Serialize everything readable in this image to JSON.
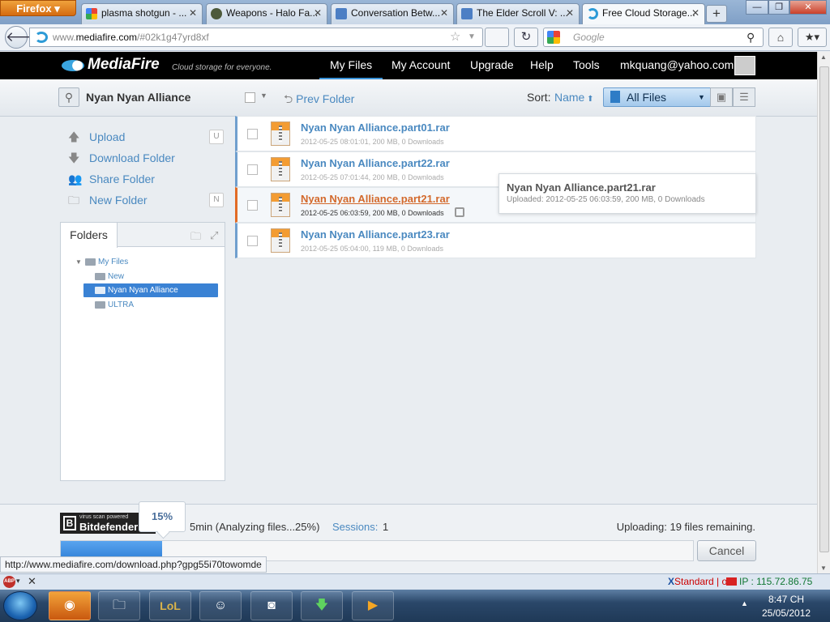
{
  "browser": {
    "menu_label": "Firefox",
    "tabs": [
      {
        "label": "plasma shotgun - ...",
        "favicon": "google-favicon"
      },
      {
        "label": "Weapons - Halo Fa...",
        "favicon": "halo-favicon"
      },
      {
        "label": "Conversation Betw...",
        "favicon": "forum-favicon"
      },
      {
        "label": "The Elder Scroll V: ...",
        "favicon": "forum-favicon"
      },
      {
        "label": "Free Cloud Storage...",
        "favicon": "mediafire-favicon",
        "active": true
      }
    ],
    "url_muted": "www.",
    "url_host": "mediafire.com",
    "url_rest": "/#02k1g47yrd8xf",
    "search_placeholder": "Google",
    "status_url": "http://www.mediafire.com/download.php?gpg55i70towomde"
  },
  "header": {
    "logo": "MediaFire",
    "tagline": "Cloud storage for everyone.",
    "nav": [
      "My Files",
      "My Account",
      "Upgrade",
      "Help",
      "Tools"
    ],
    "active_nav": "My Files",
    "user_email": "mkquang@yahoo.com"
  },
  "toolbar": {
    "folder_name": "Nyan Nyan Alliance",
    "prev_folder": "Prev Folder",
    "sort_label": "Sort:",
    "sort_value": "Name",
    "filter_value": "All Files"
  },
  "sidebar": {
    "actions": [
      {
        "label": "Upload",
        "shortcut": "U",
        "icon": "upload-icon"
      },
      {
        "label": "Download Folder",
        "shortcut": "",
        "icon": "download-icon"
      },
      {
        "label": "Share Folder",
        "shortcut": "",
        "icon": "share-icon"
      },
      {
        "label": "New Folder",
        "shortcut": "N",
        "icon": "new-folder-icon"
      }
    ],
    "folders_tab": "Folders",
    "tree": {
      "root": "My Files",
      "children": [
        "New",
        "Nyan Nyan Alliance",
        "ULTRA"
      ],
      "selected": "Nyan Nyan Alliance"
    }
  },
  "files": [
    {
      "name": "Nyan Nyan Alliance.part01.rar",
      "meta": "2012-05-25 08:01:01, 200 MB, 0 Downloads"
    },
    {
      "name": "Nyan Nyan Alliance.part22.rar",
      "meta": "2012-05-25 07:01:44, 200 MB, 0 Downloads"
    },
    {
      "name": "Nyan Nyan Alliance.part21.rar",
      "meta": "2012-05-25 06:03:59, 200 MB, 0 Downloads",
      "hover": true
    },
    {
      "name": "Nyan Nyan Alliance.part23.rar",
      "meta": "2012-05-25 05:04:00, 119 MB, 0 Downloads"
    }
  ],
  "tooltip": {
    "title": "Nyan Nyan Alliance.part21.rar",
    "meta": "Uploaded: 2012-05-25 06:03:59, 200 MB, 0 Downloads"
  },
  "upload": {
    "brand_tag": "virus scan powered",
    "brand": "Bitdefender",
    "status": "5min (Analyzing files...25%)",
    "sessions_label": "Sessions:",
    "sessions_value": "1",
    "remaining": "Uploading: 19 files remaining.",
    "percent_label": "15%",
    "progress_fraction": 0.16,
    "cancel": "Cancel"
  },
  "addon_bar": {
    "standard": "Standard | off",
    "ip": "IP : 115.72.86.75"
  },
  "taskbar": {
    "time": "8:47 CH",
    "date": "25/05/2012"
  },
  "colors": {
    "accent": "#4a89c0",
    "hover_link": "#d3692c",
    "progress": "#2f7fd6",
    "header_bg": "#000000"
  }
}
